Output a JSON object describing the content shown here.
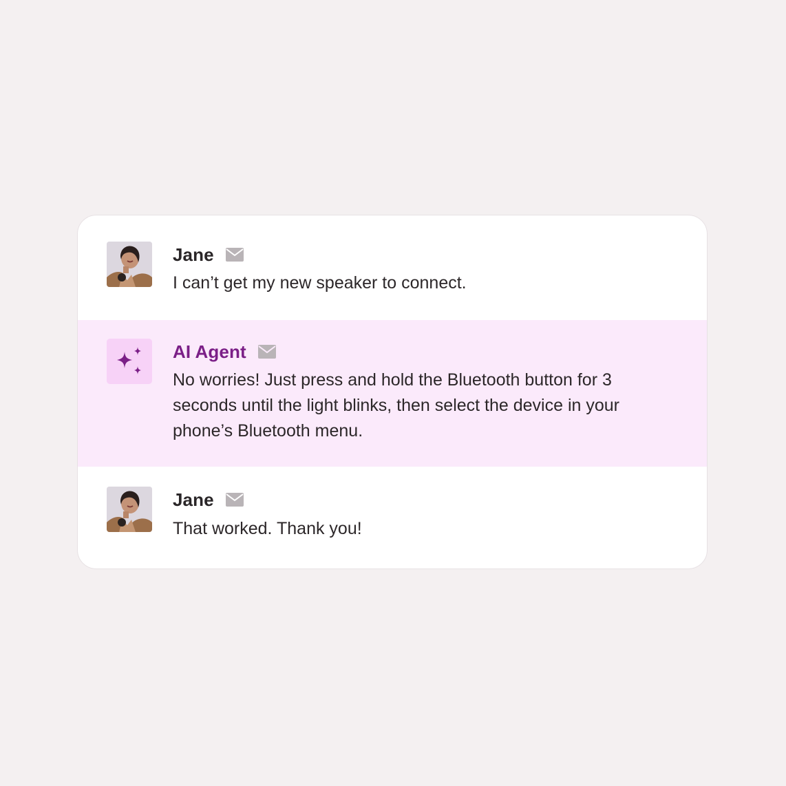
{
  "messages": [
    {
      "sender": "Jane",
      "avatar": "person-photo",
      "channel_icon": "mail-icon",
      "text": "I can’t get my new speaker to connect."
    },
    {
      "sender": "AI Agent",
      "avatar": "sparkles-icon",
      "channel_icon": "mail-icon",
      "text": "No worries! Just press and hold the Bluetooth button for 3 seconds until the light blinks, then select the device in your phone’s Bluetooth menu.",
      "highlight_color": "#fbeafb",
      "name_color": "#7b1f87"
    },
    {
      "sender": "Jane",
      "avatar": "person-photo",
      "channel_icon": "mail-icon",
      "text": "That worked. Thank you!"
    }
  ]
}
